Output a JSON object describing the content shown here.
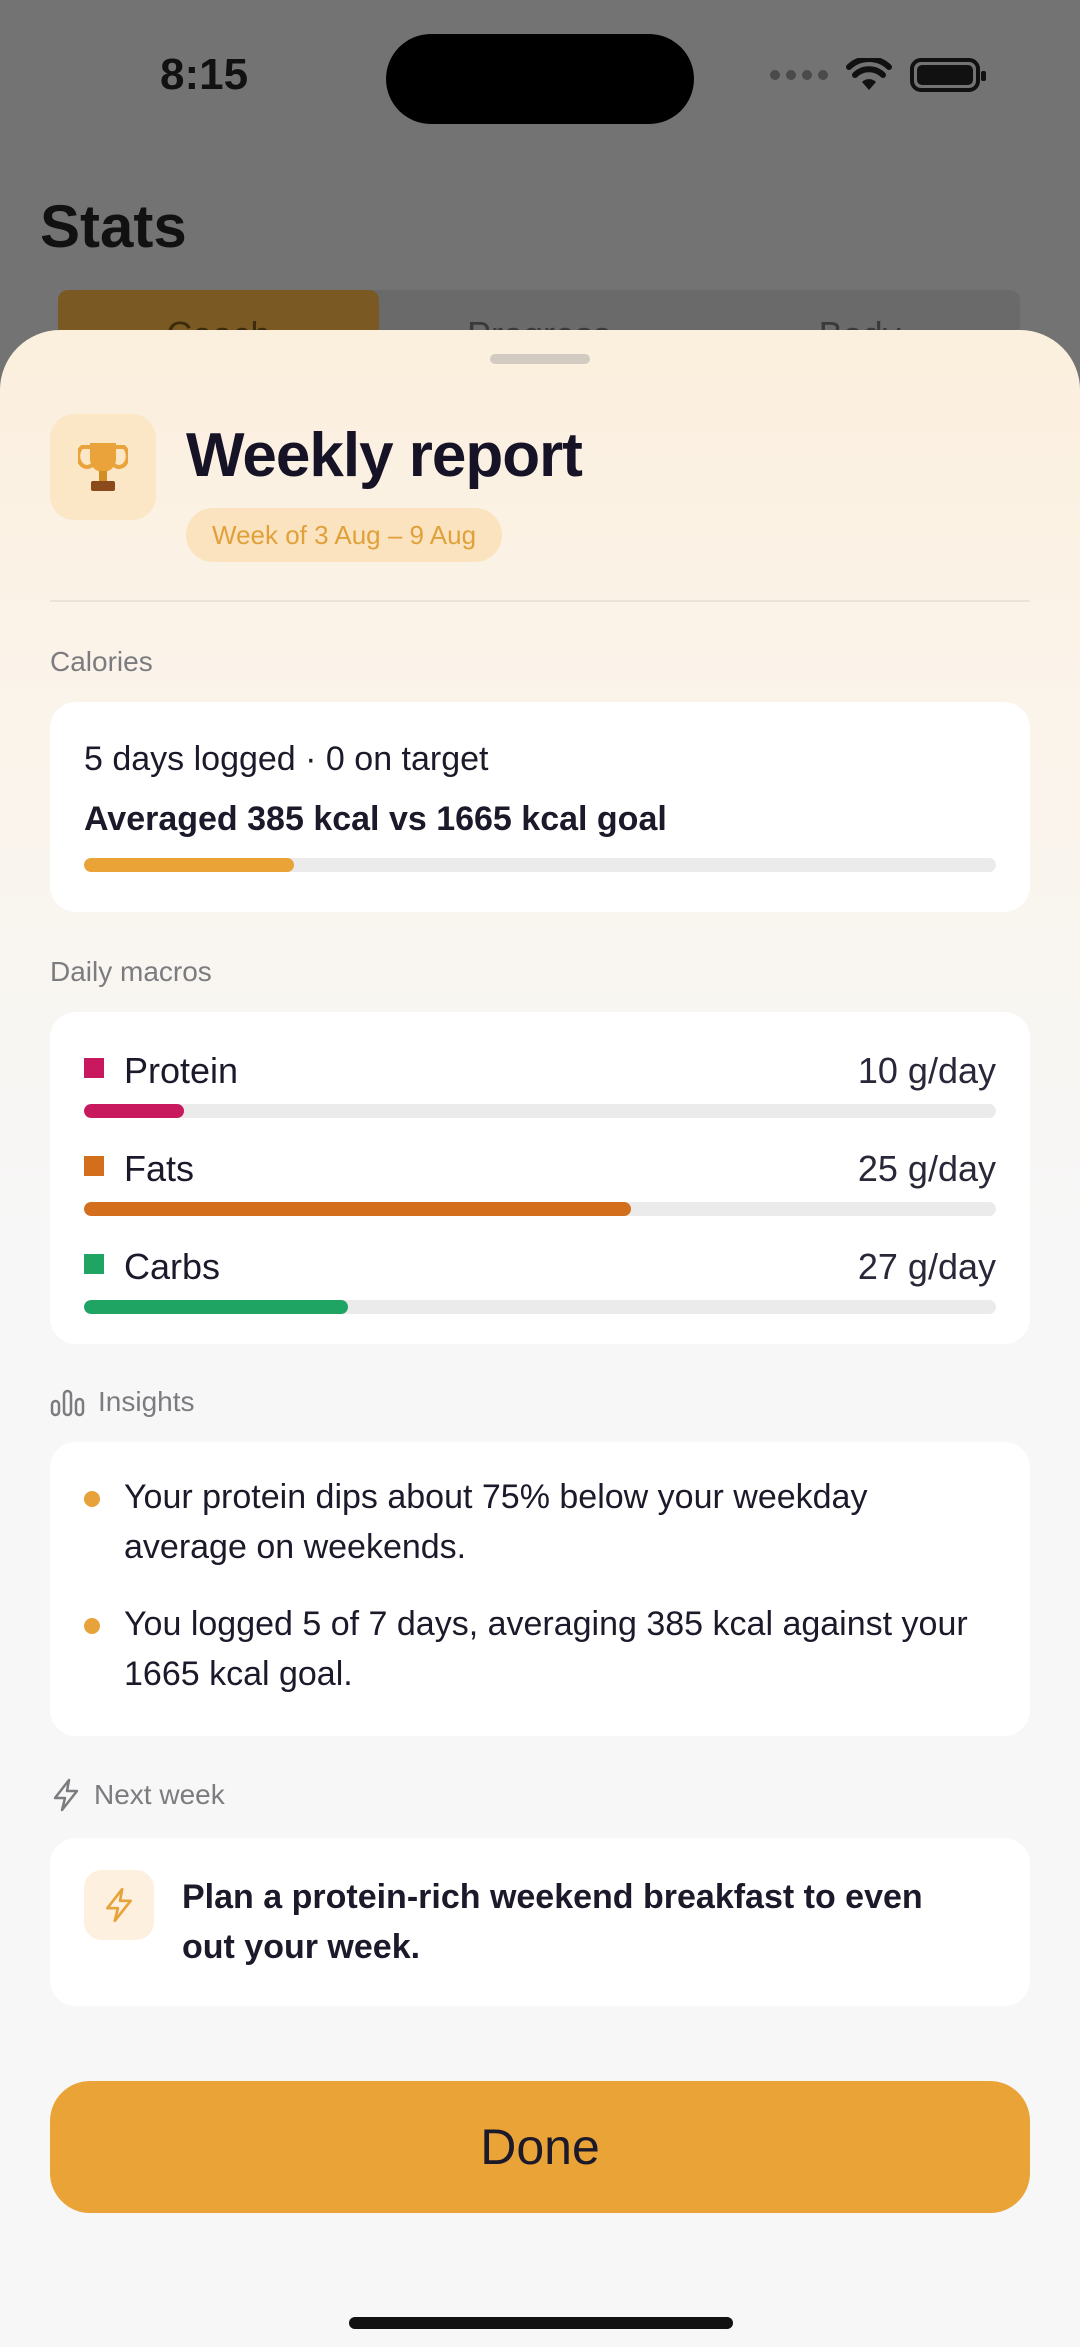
{
  "status_bar": {
    "time": "8:15"
  },
  "background": {
    "title": "Stats",
    "tabs": [
      "Coach",
      "Progress",
      "Body"
    ]
  },
  "sheet": {
    "title": "Weekly report",
    "week_pill": "Week of 3 Aug – 9 Aug",
    "calories": {
      "section_label": "Calories",
      "line1": "5 days logged · 0 on target",
      "line2": "Averaged 385 kcal vs 1665 kcal goal",
      "progress_fraction": 0.23,
      "bar_color": "#e9a337"
    },
    "macros": {
      "section_label": "Daily macros",
      "items": [
        {
          "name": "Protein",
          "value": "10 g/day",
          "fraction": 0.11,
          "color": "#c8195f"
        },
        {
          "name": "Fats",
          "value": "25 g/day",
          "fraction": 0.6,
          "color": "#d36e1d"
        },
        {
          "name": "Carbs",
          "value": "27 g/day",
          "fraction": 0.29,
          "color": "#1fa463"
        }
      ]
    },
    "insights": {
      "section_label": "Insights",
      "items": [
        "Your protein dips about 75% below your weekday average on weekends.",
        "You logged 5 of 7 days, averaging 385 kcal against your 1665 kcal goal."
      ]
    },
    "next_week": {
      "section_label": "Next week",
      "tip": "Plan a protein-rich weekend breakfast to even out your week."
    },
    "done_label": "Done"
  },
  "colors": {
    "accent": "#e9a337",
    "protein": "#c8195f",
    "fats": "#d36e1d",
    "carbs": "#1fa463"
  }
}
